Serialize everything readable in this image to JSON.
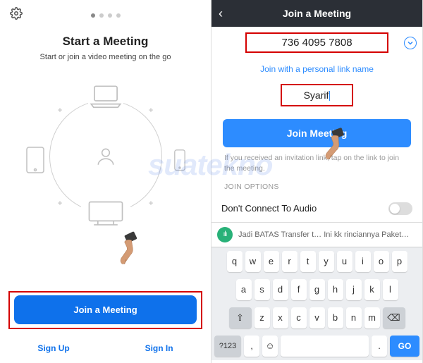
{
  "left": {
    "title": "Start a Meeting",
    "subtitle": "Start or join a video meeting on the go",
    "join_button": "Join a Meeting",
    "sign_up": "Sign Up",
    "sign_in": "Sign In"
  },
  "right": {
    "header": "Join a Meeting",
    "meeting_id": "736 4095 7808",
    "personal_link": "Join with a personal link name",
    "name_value": "Syarif",
    "join_button": "Join Meeting",
    "hint": "If you received an invitation link, tap on the link to join the meeting.",
    "section_label": "JOIN OPTIONS",
    "audio_option": "Don't Connect To Audio",
    "suggestion": "Jadi  BATAS Transfer t…   Ini kk rinciannya  Paket…"
  },
  "keyboard": {
    "row1": [
      "q",
      "w",
      "e",
      "r",
      "t",
      "y",
      "u",
      "i",
      "o",
      "p"
    ],
    "row2": [
      "a",
      "s",
      "d",
      "f",
      "g",
      "h",
      "j",
      "k",
      "l"
    ],
    "row3": [
      "z",
      "x",
      "c",
      "v",
      "b",
      "n",
      "m"
    ],
    "shift": "⇧",
    "backspace": "⌫",
    "sym": "?123",
    "comma": ",",
    "period": ".",
    "emoji": "☺",
    "go": "GO"
  },
  "watermark": "suatekno"
}
